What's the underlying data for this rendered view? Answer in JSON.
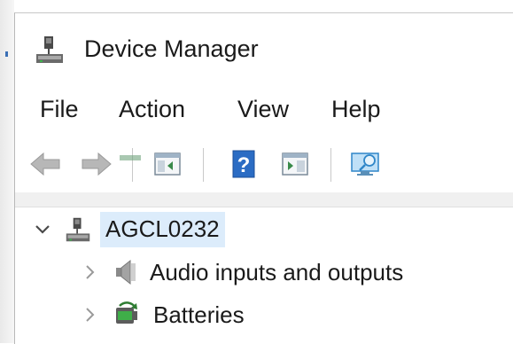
{
  "window": {
    "title": "Device Manager"
  },
  "menu": {
    "items": [
      "File",
      "Action",
      "View",
      "Help"
    ]
  },
  "toolbar": {
    "buttons": [
      "back-icon",
      "forward-icon",
      "show-hide-console-tree-icon",
      "help-icon",
      "properties-icon",
      "scan-hardware-icon"
    ]
  },
  "tree": {
    "root": {
      "label": "AGCL0232",
      "expanded": true
    },
    "items": [
      {
        "label": "Audio inputs and outputs",
        "icon": "speaker-icon"
      },
      {
        "label": "Batteries",
        "icon": "battery-icon"
      }
    ]
  },
  "colors": {
    "selection": "#dcecfb",
    "accent": "#2b6cc4"
  }
}
